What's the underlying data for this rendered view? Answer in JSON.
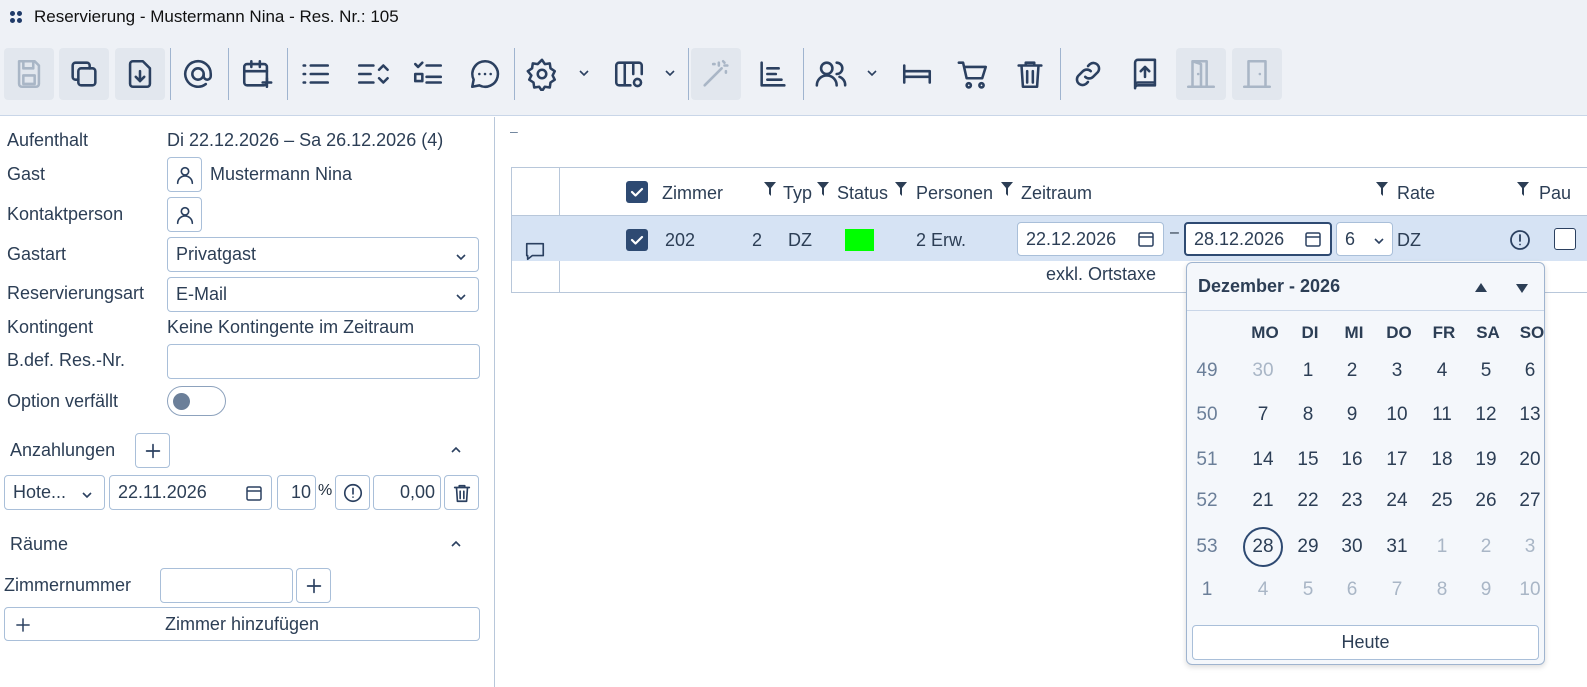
{
  "window": {
    "title": "Reservierung - Mustermann Nina - Res. Nr.: 105"
  },
  "toolbar": {
    "icons": [
      "save-icon",
      "copy-icon",
      "download-icon",
      "at-icon",
      "calendar-plus-icon",
      "list-icon",
      "sort-list-icon",
      "checklist-icon",
      "chat-icon",
      "gear-icon",
      "columns-settings-icon",
      "magic-wand-icon",
      "chart-icon",
      "users-icon",
      "bed-icon",
      "cart-icon",
      "trash-icon",
      "link-icon",
      "upload-book-icon",
      "door-open-icon",
      "door-icon"
    ]
  },
  "left": {
    "aufenthalt_label": "Aufenthalt",
    "aufenthalt_value": "Di 22.12.2026 – Sa 26.12.2026 (4)",
    "gast_label": "Gast",
    "gast_value": "Mustermann Nina",
    "kontakt_label": "Kontaktperson",
    "gastart_label": "Gastart",
    "gastart_value": "Privatgast",
    "resart_label": "Reservierungsart",
    "resart_value": "E-Mail",
    "kontingent_label": "Kontingent",
    "kontingent_value": "Keine Kontingente im Zeitraum",
    "bdef_label": "B.def. Res.-Nr.",
    "bdef_value": "",
    "option_label": "Option verfällt",
    "option_on": false,
    "anzahlungen_label": "Anzahlungen",
    "anz_type": "Hote...",
    "anz_date": "22.11.2026",
    "anz_percent": "10",
    "anz_percent_sign": "%",
    "anz_amount": "0,00",
    "raeume_label": "Räume",
    "zimmernummer_label": "Zimmernummer",
    "zimmernummer_value": "",
    "add_room_label": "Zimmer hinzufügen"
  },
  "main": {
    "dash": "–",
    "columns": {
      "zimmer": "Zimmer",
      "typ": "Typ",
      "status": "Status",
      "personen": "Personen",
      "zeitraum": "Zeitraum",
      "rate": "Rate",
      "pau": "Pau"
    },
    "row": {
      "zimmer": "202",
      "count": "2",
      "typ": "DZ",
      "status_color": "#00ff00",
      "personen": "2 Erw.",
      "from": "22.12.2026",
      "range_sep": "–",
      "to": "28.12.2026",
      "nights": "6",
      "rate": "DZ",
      "note": "exkl. Ortstaxe"
    }
  },
  "calendar": {
    "header": "Dezember - 2026",
    "weekdays": [
      "MO",
      "DI",
      "MI",
      "DO",
      "FR",
      "SA",
      "SO"
    ],
    "weeks": [
      {
        "wk": "49",
        "days": [
          "30",
          "1",
          "2",
          "3",
          "4",
          "5",
          "6"
        ]
      },
      {
        "wk": "50",
        "days": [
          "7",
          "8",
          "9",
          "10",
          "11",
          "12",
          "13"
        ]
      },
      {
        "wk": "51",
        "days": [
          "14",
          "15",
          "16",
          "17",
          "18",
          "19",
          "20"
        ]
      },
      {
        "wk": "52",
        "days": [
          "21",
          "22",
          "23",
          "24",
          "25",
          "26",
          "27"
        ]
      },
      {
        "wk": "53",
        "days": [
          "28",
          "29",
          "30",
          "31",
          "1",
          "2",
          "3"
        ]
      },
      {
        "wk": "1",
        "days": [
          "4",
          "5",
          "6",
          "7",
          "8",
          "9",
          "10"
        ]
      }
    ],
    "today_label": "Heute"
  }
}
